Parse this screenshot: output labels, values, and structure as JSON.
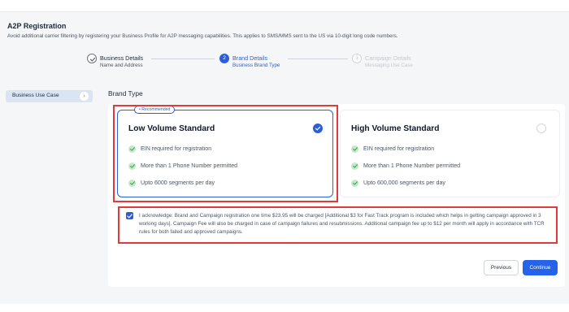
{
  "header": {
    "title": "A2P Registration",
    "subtitle": "Avoid additional carrier filtering by registering your Business Profile for A2P messaging capabilities. This applies to SMS/MMS sent to the US via 10-digit long code numbers."
  },
  "stepper": {
    "steps": [
      {
        "number": "",
        "title": "Business Details",
        "subtitle": "Name and Address",
        "state": "completed"
      },
      {
        "number": "2",
        "title": "Brand Details",
        "subtitle": "Business Brand Type",
        "state": "active"
      },
      {
        "number": "3",
        "title": "Campaign Details",
        "subtitle": "Messaging Use Case",
        "state": "pending"
      }
    ]
  },
  "sidebar": {
    "items": [
      {
        "label": "Business Use Case",
        "icon": "chevron-right-icon",
        "active": true
      }
    ]
  },
  "main": {
    "section_title": "Brand Type",
    "cards": [
      {
        "badge": "• Recommended",
        "title": "Low Volume Standard",
        "selected": true,
        "features": [
          "EIN required for registration",
          "More than 1 Phone Number permitted",
          "Upto 6000 segments per day"
        ]
      },
      {
        "badge": "",
        "title": "High Volume Standard",
        "selected": false,
        "features": [
          "EIN required for registration",
          "More than 1 Phone Number permitted",
          "Upto 600,000 segments per day"
        ]
      }
    ],
    "acknowledgement": {
      "checked": true,
      "text": "I acknowledge: Brand and Campaign registration one time $23.95 will be charged [Additional $3 for Fast Track program is included which helps in getting campaign approved in 3 working days]. Campaign Fee will also be charged in case of campaign failures and resubmissions. Additional campaign fee up to $12 per month will apply in accordance with TCR rules for both failed and approved campaigns."
    }
  },
  "footer": {
    "previous_label": "Previous",
    "continue_label": "Continue"
  },
  "colors": {
    "accent": "#2b5fd9",
    "button_primary": "#2563eb",
    "check_green": "#34a853",
    "highlight_red": "#e03a3a"
  }
}
